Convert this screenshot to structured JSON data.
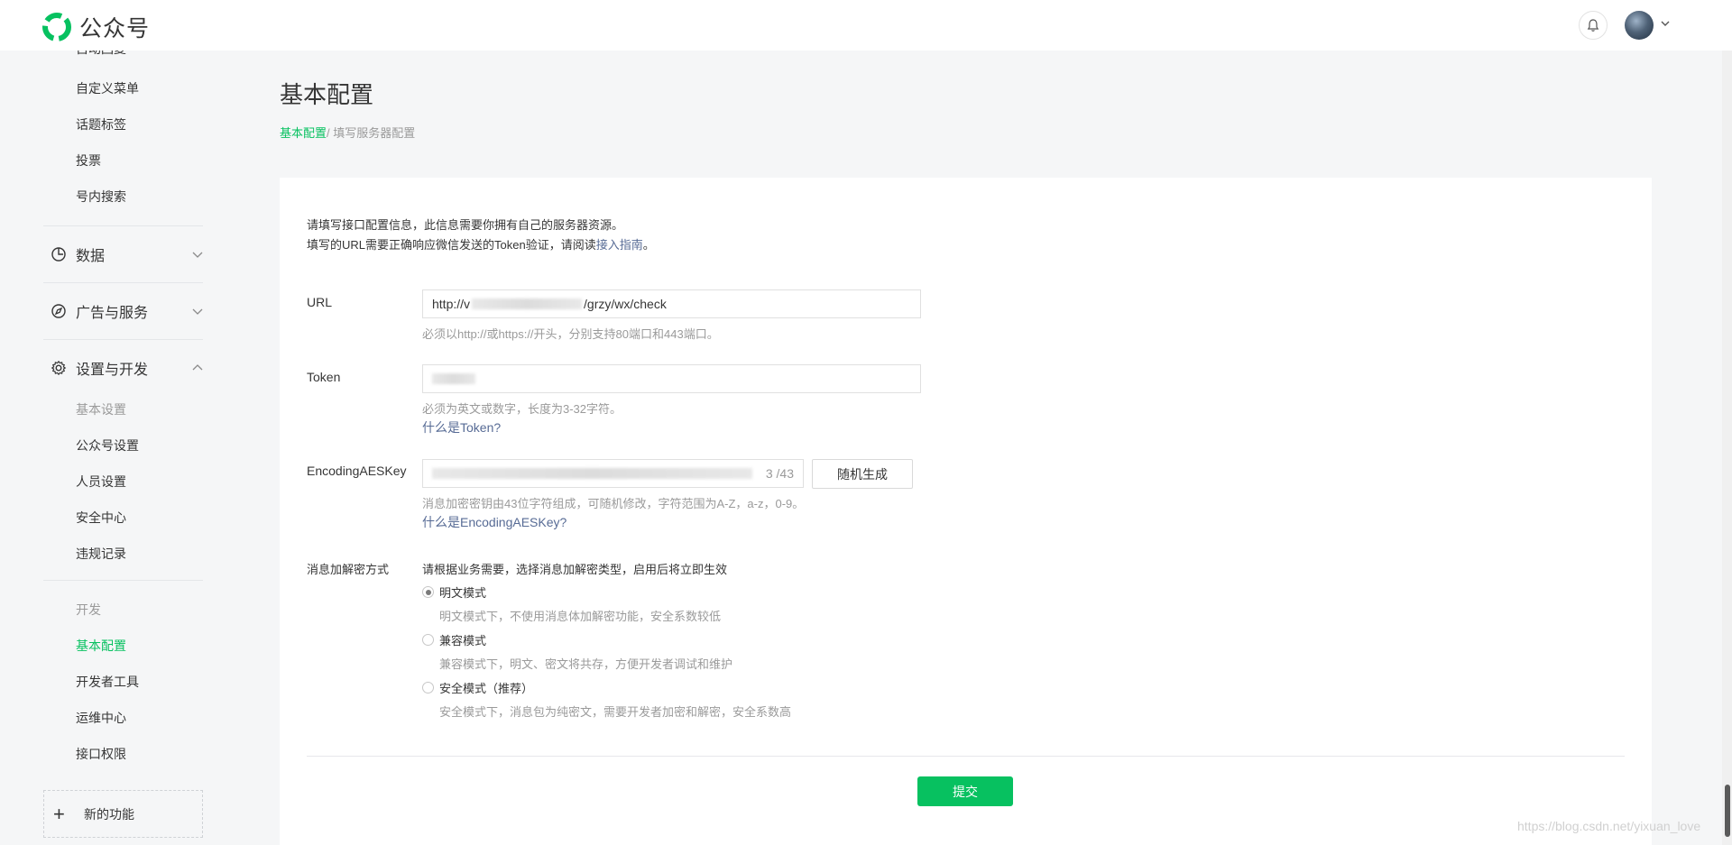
{
  "app": {
    "name": "公众号"
  },
  "header": {
    "avatar_caret": "⌄"
  },
  "sidebar": {
    "top_items": [
      "自动回复",
      "自定义菜单",
      "话题标签",
      "投票",
      "号内搜索"
    ],
    "groups": {
      "data": "数据",
      "ads": "广告与服务",
      "settings": "设置与开发"
    },
    "settings_items": {
      "section": "基本设置",
      "items": [
        "公众号设置",
        "人员设置",
        "安全中心",
        "违规记录"
      ]
    },
    "dev_items": {
      "section": "开发",
      "items": [
        "基本配置",
        "开发者工具",
        "运维中心",
        "接口权限"
      ],
      "active": "基本配置"
    },
    "new_feature": "新的功能"
  },
  "page": {
    "title": "基本配置",
    "breadcrumb": {
      "link": "基本配置",
      "current": "/ 填写服务器配置"
    }
  },
  "form": {
    "intro_line1": "请填写接口配置信息，此信息需要你拥有自己的服务器资源。",
    "intro_line2_prefix": "填写的URL需要正确响应微信发送的Token验证，请阅读",
    "intro_line2_link": "接入指南",
    "intro_line2_suffix": "。",
    "url": {
      "label": "URL",
      "value_prefix": "http://v",
      "value_suffix": "/grzy/wx/check",
      "hint": "必须以http://或https://开头，分别支持80端口和443端口。"
    },
    "token": {
      "label": "Token",
      "hint": "必须为英文或数字，长度为3-32字符。",
      "help": "什么是Token?"
    },
    "aeskey": {
      "label": "EncodingAESKey",
      "counter": "3 /43",
      "generate": "随机生成",
      "hint": "消息加密密钥由43位字符组成，可随机修改，字符范围为A-Z，a-z，0-9。",
      "help": "什么是EncodingAESKey?"
    },
    "encryption": {
      "label": "消息加解密方式",
      "intro": "请根据业务需要，选择消息加解密类型，启用后将立即生效",
      "options": [
        {
          "label": "明文模式",
          "desc": "明文模式下，不使用消息体加解密功能，安全系数较低",
          "checked": true
        },
        {
          "label": "兼容模式",
          "desc": "兼容模式下，明文、密文将共存，方便开发者调试和维护",
          "checked": false
        },
        {
          "label": "安全模式（推荐）",
          "desc": "安全模式下，消息包为纯密文，需要开发者加密和解密，安全系数高",
          "checked": false
        }
      ]
    },
    "submit": "提交"
  },
  "watermark": "https://blog.csdn.net/yixuan_love",
  "colors": {
    "brand": "#07c160",
    "link": "#576b95"
  }
}
